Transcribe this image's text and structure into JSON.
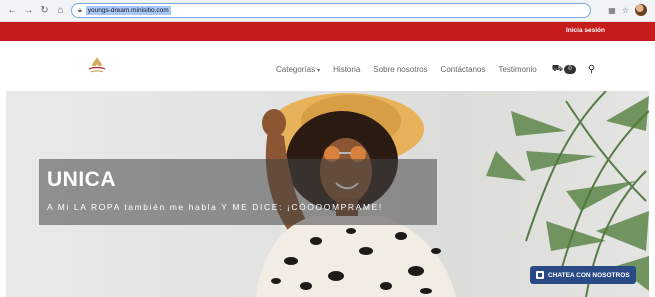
{
  "browser": {
    "url": "youngs-dream.minisitio.com"
  },
  "topbar": {
    "login_label": "Inicia sesión"
  },
  "header": {
    "nav_items": [
      {
        "label": "Categorías",
        "has_caret": true
      },
      {
        "label": "Historia"
      },
      {
        "label": "Sobre nosotros"
      },
      {
        "label": "Contáctanos"
      },
      {
        "label": "Testimonio"
      }
    ],
    "cart_count": "0"
  },
  "hero": {
    "title": "UNICA",
    "subtitle": "A Mi LA ROPA también me habla Y ME DICE: ¡CÓOOOMPRAME!"
  },
  "chat": {
    "label": "CHATEA CON NOSOTROS"
  },
  "colors": {
    "brand_red": "#c71c1c",
    "chat_blue": "#2a4a86",
    "hat": "#e7b25a"
  },
  "icons": [
    "back-arrow-icon",
    "forward-arrow-icon",
    "reload-icon",
    "home-icon",
    "lock-icon",
    "qr-icon",
    "star-icon",
    "cart-icon",
    "search-icon",
    "chat-icon"
  ]
}
